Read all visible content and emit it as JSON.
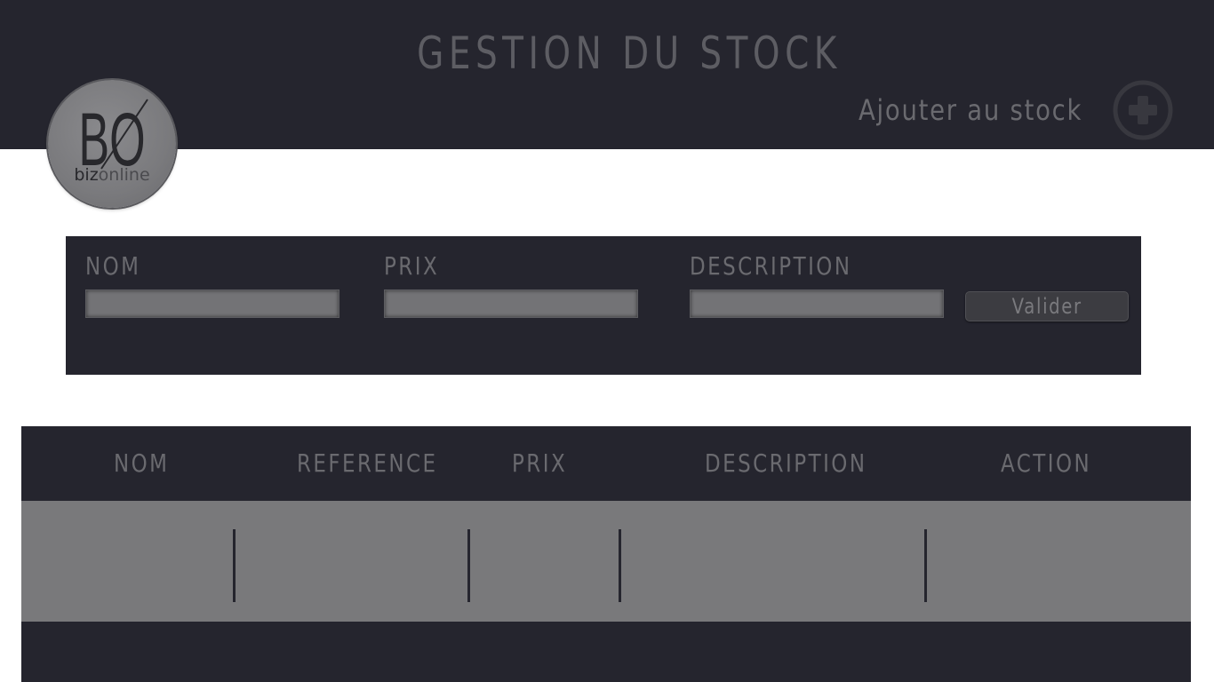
{
  "header": {
    "title": "GESTION DU STOCK",
    "add_stock_label": "Ajouter au stock",
    "add_stock_icon": "plus-circle-icon"
  },
  "logo": {
    "monogram": "BO",
    "brand_biz": "biz",
    "brand_online": "online"
  },
  "form": {
    "fields": [
      {
        "label": "NOM",
        "value": ""
      },
      {
        "label": "PRIX",
        "value": ""
      },
      {
        "label": "DESCRIPTION",
        "value": ""
      }
    ],
    "submit_label": "Valider"
  },
  "table": {
    "columns": [
      "NOM",
      "REFERENCE",
      "PRIX",
      "DESCRIPTION",
      "ACTION"
    ],
    "rows": [
      [
        "",
        "",
        "",
        "",
        ""
      ]
    ]
  },
  "colors": {
    "dark_panel": "#25252e",
    "muted_text": "#6a6a6f",
    "input_fill": "#737376",
    "row_fill": "#79797b"
  }
}
